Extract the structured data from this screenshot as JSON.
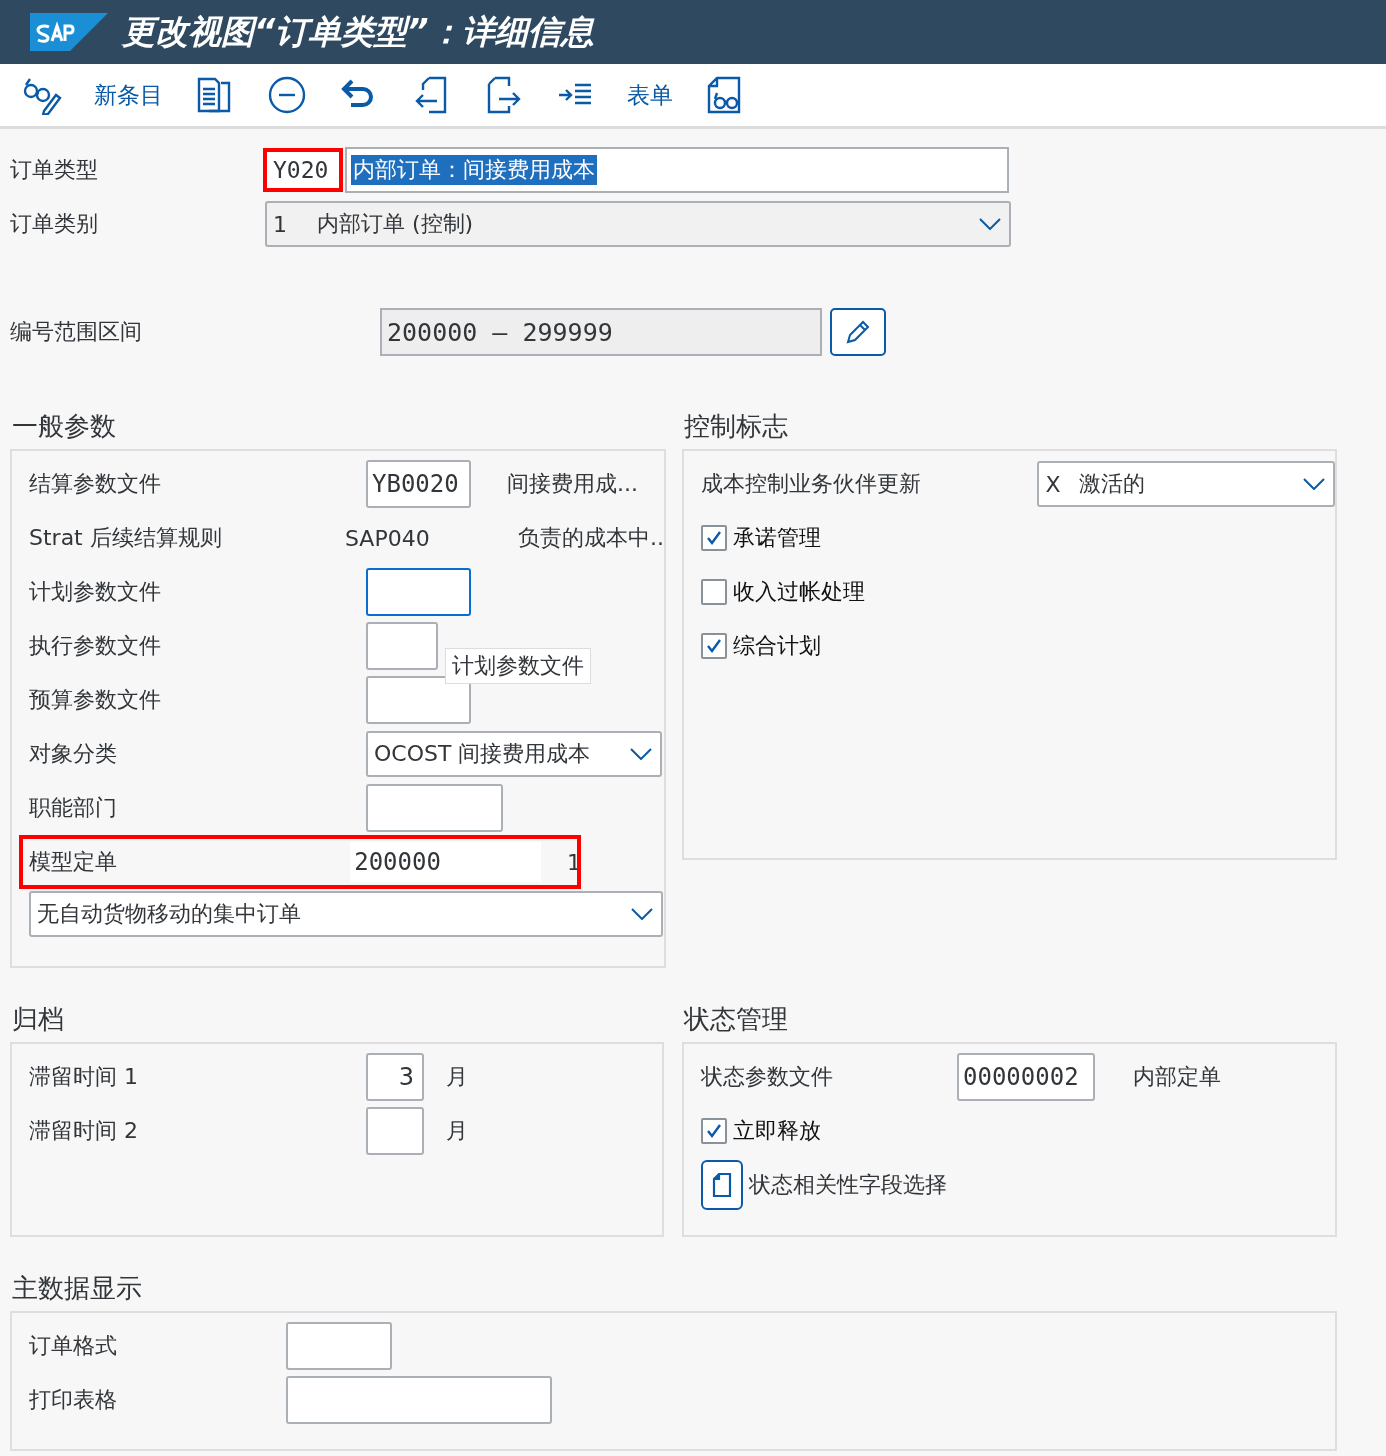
{
  "window": {
    "title": "更改视图“订单类型”：详细信息"
  },
  "toolbar": [
    {
      "kind": "icon"
    },
    {
      "kind": "text",
      "label": "新条目"
    },
    {
      "kind": "icon"
    },
    {
      "kind": "icon"
    },
    {
      "kind": "icon"
    },
    {
      "kind": "icon"
    },
    {
      "kind": "icon"
    },
    {
      "kind": "icon"
    },
    {
      "kind": "text",
      "label": "表单"
    },
    {
      "kind": "icon"
    }
  ],
  "order_type": {
    "label": "订单类型",
    "code": "Y020",
    "description": "内部订单：间接费用成本",
    "highlighted": true
  },
  "order_category": {
    "label": "订单类别",
    "code": "1",
    "text": "内部订单 (控制)"
  },
  "number_range": {
    "label": "编号范围区间",
    "value": "200000 – 299999"
  },
  "general_params": {
    "title": "一般参数",
    "rows": [
      {
        "kind": "input",
        "label": "结算参数文件",
        "value": "YB0020",
        "text": "间接费用成...",
        "focused": false,
        "highlighted": false
      },
      {
        "kind": "display",
        "label": "Strat 后续结算规则",
        "value": "SAP040",
        "text": "负责的成本中.."
      },
      {
        "kind": "input",
        "label": "计划参数文件",
        "focused": true,
        "highlighted": false
      },
      {
        "kind": "input",
        "label": "执行参数文件",
        "focused": false,
        "highlighted": false
      },
      {
        "kind": "input",
        "label": "预算参数文件",
        "focused": false,
        "highlighted": false
      },
      {
        "kind": "select",
        "label": "对象分类",
        "value": "OCOST  间接费用成本"
      },
      {
        "kind": "input",
        "label": "职能部门",
        "focused": false,
        "highlighted": false
      },
      {
        "kind": "input",
        "label": "模型定单",
        "value": "200000",
        "text": "1",
        "focused": false,
        "highlighted": true
      }
    ],
    "select": "无自动货物移动的集中订单",
    "tooltip": "计划参数文件"
  },
  "control_flags": {
    "title": "控制标志",
    "rows": [
      {
        "kind": "select",
        "label": "成本控制业务伙伴更新",
        "code": "X",
        "text": "激活的"
      },
      {
        "kind": "checkbox",
        "label": "承诺管理",
        "checked": true
      },
      {
        "kind": "checkbox",
        "label": "收入过帐处理",
        "checked": false
      },
      {
        "kind": "checkbox",
        "label": "综合计划",
        "checked": true
      }
    ]
  },
  "archiving": {
    "title": "归档",
    "rows": [
      {
        "label": "滞留时间 1",
        "value": "3",
        "unit": "月"
      },
      {
        "label": "滞留时间 2",
        "unit": "月"
      }
    ]
  },
  "status_management": {
    "title": "状态管理",
    "profile_label": "状态参数文件",
    "profile_value": "00000002",
    "profile_text": "内部定单",
    "release": {
      "label": "立即释放",
      "checked": true
    },
    "button": "状态相关性字段选择"
  },
  "master_data": {
    "title": "主数据显示",
    "rows": [
      {
        "label": "订单格式"
      },
      {
        "label": "打印表格"
      }
    ]
  }
}
